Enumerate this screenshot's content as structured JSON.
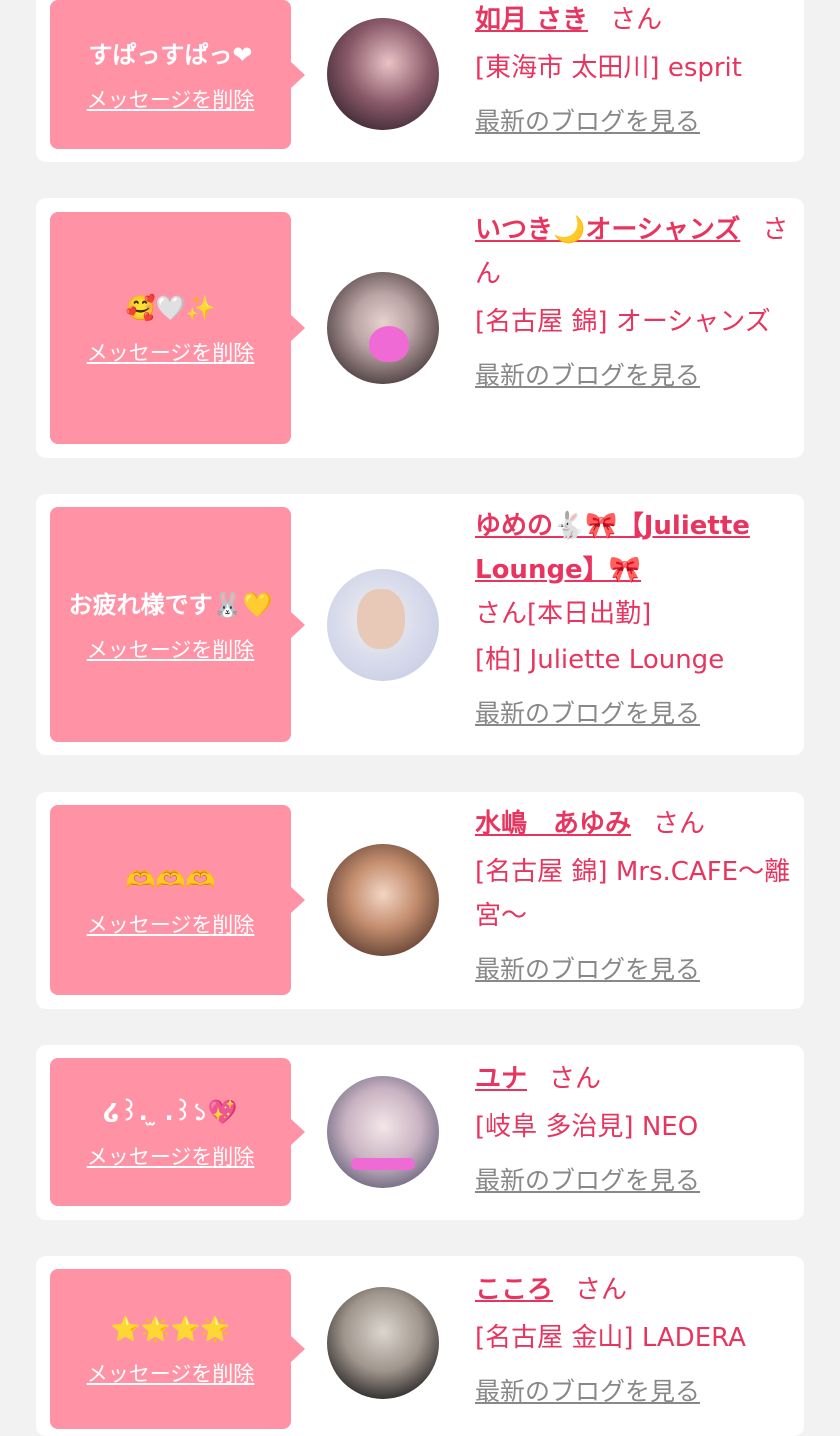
{
  "delete_label": "メッセージを削除",
  "blog_label": "最新のブログを見る",
  "suffix": "さん",
  "items": [
    {
      "message": "すぱっすぱっ❤",
      "name": "如月 さき",
      "status": "",
      "shop": "[東海市 太田川] esprit"
    },
    {
      "message": "🥰🤍✨",
      "name": "いつき🌙オーシャンズ",
      "status": "",
      "shop": "[名古屋 錦] オーシャンズ"
    },
    {
      "message": "お疲れ様です🐰💛",
      "name": "ゆめの🐇🎀【Juliette Lounge】🎀",
      "status": "[本日出勤]",
      "shop": "[柏] Juliette Lounge"
    },
    {
      "message": "🫶🫶🫶",
      "name": "水嶋　あゆみ",
      "status": "",
      "shop": "[名古屋 錦] Mrs.CAFE〜離宮〜"
    },
    {
      "message": "໒꒱.  ̫ .꒱১💖",
      "name": "ユナ",
      "status": "",
      "shop": "[岐阜 多治見] NEO"
    },
    {
      "message": "⭐🌟⭐🌟",
      "name": "こころ",
      "status": "",
      "shop": "[名古屋 金山] LADERA"
    }
  ],
  "colors": {
    "accent": "#e8355f",
    "bubble": "#ff92a5",
    "link_gray": "#888888"
  }
}
